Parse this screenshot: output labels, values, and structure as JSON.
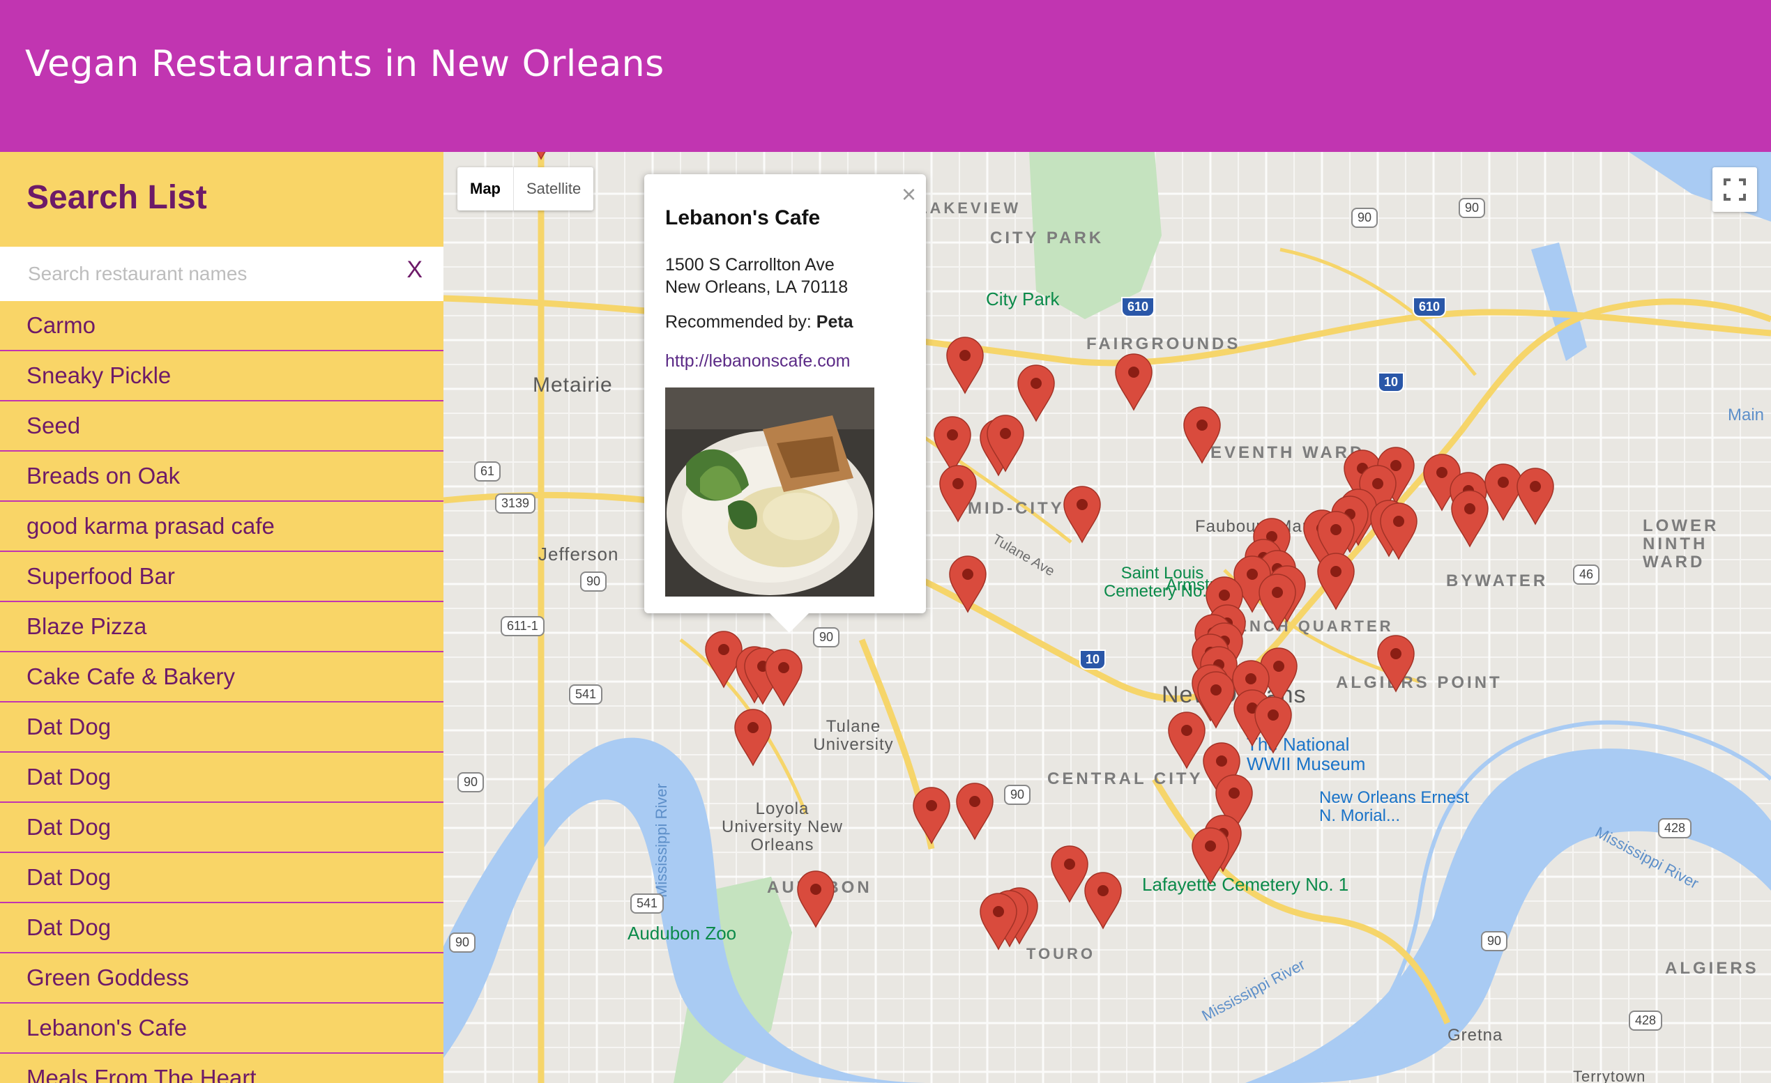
{
  "header": {
    "title": "Vegan Restaurants in New Orleans"
  },
  "sidebar": {
    "title": "Search List",
    "search_placeholder": "Search restaurant names",
    "search_value": "",
    "clear_label": "X",
    "items": [
      "Carmo",
      "Sneaky Pickle",
      "Seed",
      "Breads on Oak",
      "good karma prasad cafe",
      "Superfood Bar",
      "Blaze Pizza",
      "Cake Cafe & Bakery",
      "Dat Dog",
      "Dat Dog",
      "Dat Dog",
      "Dat Dog",
      "Dat Dog",
      "Green Goddess",
      "Lebanon's Cafe",
      "Meals From The Heart"
    ]
  },
  "map": {
    "type_buttons": {
      "map": "Map",
      "satellite": "Satellite"
    },
    "fullscreen_icon": "fullscreen-icon",
    "labels": {
      "metairie": "Metairie",
      "jefferson": "Jefferson",
      "city_park_area": "CITY PARK",
      "city_park": "City Park",
      "fairgrounds": "FAIRGROUNDS",
      "seventh_ward": "SEVENTH WARD",
      "mid_city": "MID-CITY",
      "faubourg": "Faubourg Marigny",
      "bywater": "BYWATER",
      "lower_ninth": "LOWER NINTH WARD",
      "new_orleans": "New Orleans",
      "algiers_point": "ALGIERS POINT",
      "central_city": "CENTRAL CITY",
      "audubon": "AUDUBON",
      "algiers": "ALGIERS",
      "gretna": "Gretna",
      "terrytown": "Terrytown",
      "tulane": "Tulane University",
      "loyola": "Loyola University New Orleans",
      "audubon_zoo": "Audubon Zoo",
      "saint_louis": "Saint Louis Cemetery No. 2",
      "lafayette": "Lafayette Cemetery No. 1",
      "ww2": "The National WWII Museum",
      "morial": "New Orleans Ernest N. Morial...",
      "armstrong": "Armstrong",
      "quarter": "FRENCH QUARTER",
      "mississippi": "Mississippi River",
      "lakeview": "LAKEVIEW",
      "touro": "TOURO",
      "tulane_ave": "Tulane Ave",
      "main": "Main"
    },
    "popup": {
      "title": "Lebanon's Cafe",
      "address_line1": "1500 S Carrollton Ave",
      "address_line2": "New Orleans, LA 70118",
      "recommended_label": "Recommended by: ",
      "recommended_by": "Peta",
      "url": "http://lebanonscafe.com",
      "close_label": "×"
    }
  },
  "colors": {
    "header": "#c135b1",
    "sidebar": "#f9d567",
    "accent_text": "#6d1a68",
    "marker": "#d94b3d",
    "water": "#a9cbf3",
    "park": "#c5e3bf"
  }
}
